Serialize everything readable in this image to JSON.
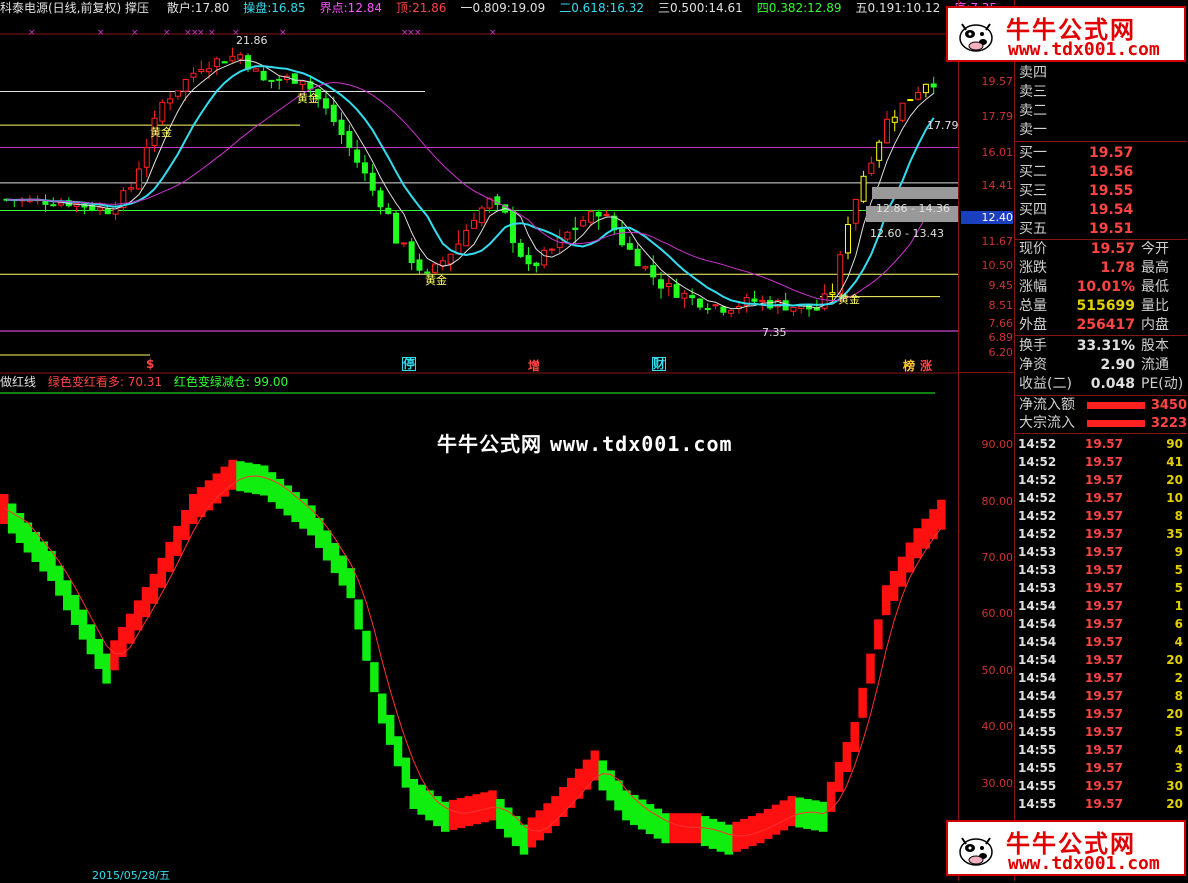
{
  "header": {
    "title": "科泰电源(日线,前复权) 撑压",
    "items": [
      {
        "label": "散户:",
        "value": "17.80",
        "color": "#e0e0e0"
      },
      {
        "label": "操盘:",
        "value": "16.85",
        "color": "#33ddee"
      },
      {
        "label": "界点:",
        "value": "12.84",
        "color": "#ff55ff"
      },
      {
        "label": "顶:",
        "value": "21.86",
        "color": "#ff4444"
      },
      {
        "label": "一0.809:",
        "value": "19.09",
        "color": "#e0e0e0"
      },
      {
        "label": "二0.618:",
        "value": "16.32",
        "color": "#33ddee"
      },
      {
        "label": "三0.500:",
        "value": "14.61",
        "color": "#e0e0e0"
      },
      {
        "label": "四0.382:",
        "value": "12.89",
        "color": "#33ff33"
      },
      {
        "label": "五0.191:",
        "value": "10.12",
        "color": "#e0e0e0"
      },
      {
        "label": "底:",
        "value": "7.35",
        "color": "#ff55ff"
      }
    ]
  },
  "main_axis": [
    "19.57",
    "17.79",
    "16.01",
    "14.41",
    "12.40",
    "11.67",
    "10.50",
    "9.45",
    "8.51",
    "7.66",
    "6.89",
    "6.20"
  ],
  "price_annotations": {
    "high": "21.86",
    "low": "7.35",
    "right_label": "17.79",
    "range1": "12.86 - 14.36",
    "range2": "12.60 - 13.43",
    "gold_label": "黄金"
  },
  "event_labels": [
    {
      "text": "$",
      "color": "#ff4444"
    },
    {
      "text": "停",
      "color": "#33ddee"
    },
    {
      "text": "增",
      "color": "#ff4444"
    },
    {
      "text": "财",
      "color": "#33ddee"
    },
    {
      "text": "榜",
      "color": "#ffcc33"
    },
    {
      "text": "涨",
      "color": "#ff4444"
    }
  ],
  "indicator": {
    "name": "做红线",
    "red_label": "绿色变红看多: 70.31",
    "green_label": "红色变绿减仓: 99.00",
    "axis": [
      "90.00",
      "80.00",
      "70.00",
      "60.00",
      "50.00",
      "40.00",
      "30.00"
    ]
  },
  "watermark": {
    "name": "牛牛公式网",
    "url": "www.tdx001.com"
  },
  "logo": {
    "title": "牛牛公式网",
    "url": "www.tdx001.com"
  },
  "order_book": {
    "asks": [
      {
        "label": "卖四",
        "value": ""
      },
      {
        "label": "卖三",
        "value": ""
      },
      {
        "label": "卖二",
        "value": ""
      },
      {
        "label": "卖一",
        "value": ""
      }
    ],
    "bids": [
      {
        "label": "买一",
        "value": "19.57"
      },
      {
        "label": "买二",
        "value": "19.56"
      },
      {
        "label": "买三",
        "value": "19.55"
      },
      {
        "label": "买四",
        "value": "19.54"
      },
      {
        "label": "买五",
        "value": "19.51"
      }
    ]
  },
  "stats": [
    {
      "label": "现价",
      "value": "19.57",
      "color": "#ff4444",
      "label2": "今开"
    },
    {
      "label": "涨跌",
      "value": "1.78",
      "color": "#ff4444",
      "label2": "最高"
    },
    {
      "label": "涨幅",
      "value": "10.01%",
      "color": "#ff4444",
      "label2": "最低"
    },
    {
      "label": "总量",
      "value": "515699",
      "color": "#e0d000",
      "label2": "量比"
    },
    {
      "label": "外盘",
      "value": "256417",
      "color": "#ff4444",
      "label2": "内盘"
    },
    {
      "label": "换手",
      "value": "33.31%",
      "color": "#e0e0e0",
      "label2": "股本"
    },
    {
      "label": "净资",
      "value": "2.90",
      "color": "#e0e0e0",
      "label2": "流通"
    },
    {
      "label": "收益(二)",
      "value": "0.048",
      "color": "#e0e0e0",
      "label2": "PE(动)"
    }
  ],
  "flows": [
    {
      "label": "净流入额",
      "value": "3450"
    },
    {
      "label": "大宗流入",
      "value": "3223"
    }
  ],
  "ticks": [
    {
      "time": "14:52",
      "price": "19.57",
      "vol": "90"
    },
    {
      "time": "14:52",
      "price": "19.57",
      "vol": "41"
    },
    {
      "time": "14:52",
      "price": "19.57",
      "vol": "20"
    },
    {
      "time": "14:52",
      "price": "19.57",
      "vol": "10"
    },
    {
      "time": "14:52",
      "price": "19.57",
      "vol": "8"
    },
    {
      "time": "14:52",
      "price": "19.57",
      "vol": "35"
    },
    {
      "time": "14:53",
      "price": "19.57",
      "vol": "9"
    },
    {
      "time": "14:53",
      "price": "19.57",
      "vol": "5"
    },
    {
      "time": "14:53",
      "price": "19.57",
      "vol": "5"
    },
    {
      "time": "14:54",
      "price": "19.57",
      "vol": "1"
    },
    {
      "time": "14:54",
      "price": "19.57",
      "vol": "6"
    },
    {
      "time": "14:54",
      "price": "19.57",
      "vol": "4"
    },
    {
      "time": "14:54",
      "price": "19.57",
      "vol": "20"
    },
    {
      "time": "14:54",
      "price": "19.57",
      "vol": "2"
    },
    {
      "time": "14:54",
      "price": "19.57",
      "vol": "8"
    },
    {
      "time": "14:55",
      "price": "19.57",
      "vol": "20"
    },
    {
      "time": "14:55",
      "price": "19.57",
      "vol": "5"
    },
    {
      "time": "14:55",
      "price": "19.57",
      "vol": "4"
    },
    {
      "time": "14:55",
      "price": "19.57",
      "vol": "3"
    },
    {
      "time": "14:55",
      "price": "19.57",
      "vol": "30"
    },
    {
      "time": "14:55",
      "price": "19.57",
      "vol": "20"
    }
  ],
  "bottom_labels": [
    "2015/05/28/五"
  ],
  "colors": {
    "up": "#ff2020",
    "down": "#20ff20",
    "grid": "#8a1515",
    "cyan": "#33ddee",
    "magenta": "#cc33cc",
    "yellow": "#ffff00"
  }
}
